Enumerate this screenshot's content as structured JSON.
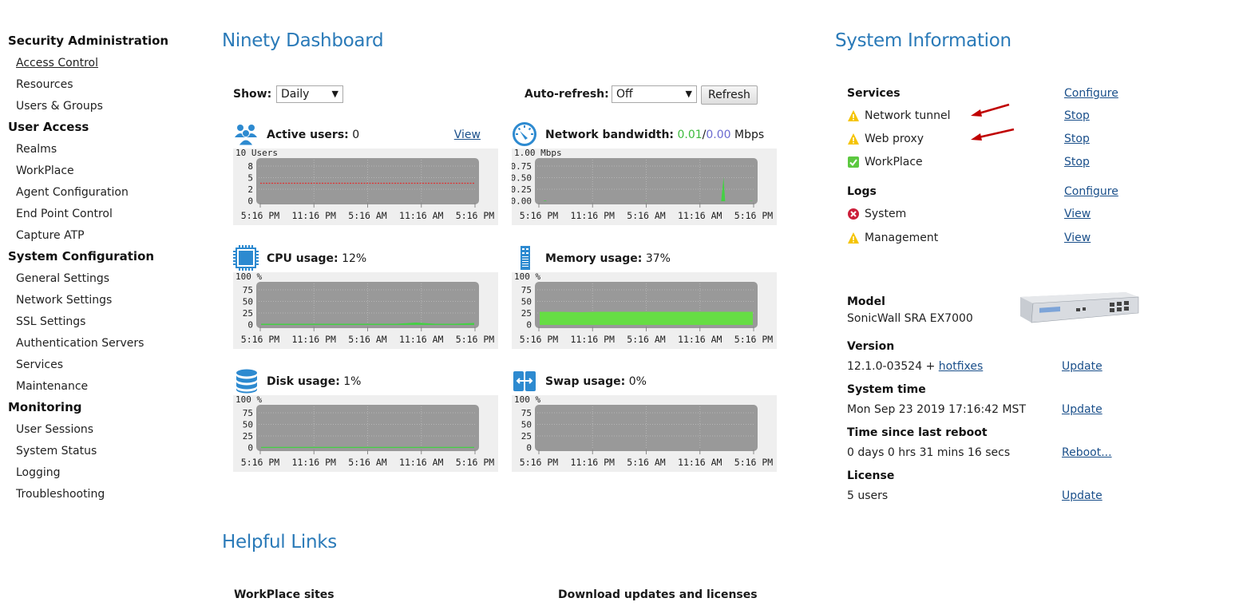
{
  "sidebar": {
    "sections": [
      {
        "title": "Security Administration",
        "items": [
          "Access Control",
          "Resources",
          "Users & Groups"
        ]
      },
      {
        "title": "User Access",
        "items": [
          "Realms",
          "WorkPlace",
          "Agent Configuration",
          "End Point Control",
          "Capture ATP"
        ]
      },
      {
        "title": "System Configuration",
        "items": [
          "General Settings",
          "Network Settings",
          "SSL Settings",
          "Authentication Servers",
          "Services",
          "Maintenance"
        ]
      },
      {
        "title": "Monitoring",
        "items": [
          "User Sessions",
          "System Status",
          "Logging",
          "Troubleshooting"
        ]
      }
    ],
    "active_item": "Access Control"
  },
  "dashboard": {
    "title": "Ninety Dashboard",
    "show_label": "Show:",
    "show_value": "Daily",
    "autorefresh_label": "Auto-refresh:",
    "autorefresh_value": "Off",
    "refresh_button": "Refresh",
    "view_link": "View"
  },
  "widgets": {
    "active_users": {
      "label": "Active users:",
      "value": "0",
      "icon": "users-icon"
    },
    "network": {
      "label": "Network bandwidth:",
      "in": "0.01",
      "sep": "/",
      "out": "0.00",
      "unit": "Mbps",
      "in_color": "#3dbb3d",
      "out_color": "#6a6ad0",
      "icon": "gauge-icon"
    },
    "cpu": {
      "label": "CPU usage:",
      "value": "12%",
      "icon": "cpu-icon"
    },
    "memory": {
      "label": "Memory usage:",
      "value": "37%",
      "icon": "memory-icon"
    },
    "disk": {
      "label": "Disk usage:",
      "value": "1%",
      "icon": "database-icon"
    },
    "swap": {
      "label": "Swap usage:",
      "value": "0%",
      "icon": "swap-icon"
    }
  },
  "chart_data": [
    {
      "id": "active_users",
      "type": "line",
      "unit_label": "10 Users",
      "yticks": [
        "8",
        "5",
        "2",
        "0"
      ],
      "ylim": [
        0,
        10
      ],
      "x": [
        "5:16 PM",
        "11:16 PM",
        "5:16 AM",
        "11:16 AM",
        "5:16 PM"
      ],
      "series": [
        {
          "name": "limit",
          "style": "dashed",
          "color": "#e03030",
          "values": [
            4.5,
            4.5,
            4.5,
            4.5,
            4.5
          ]
        },
        {
          "name": "active users",
          "color": "#44d044",
          "values": [
            0,
            0,
            0,
            0,
            0
          ]
        }
      ]
    },
    {
      "id": "network",
      "type": "area",
      "unit_label": "1.00 Mbps",
      "yticks": [
        "0.75",
        "0.50",
        "0.25",
        "0.00"
      ],
      "ylim": [
        0,
        1.0
      ],
      "x": [
        "5:16 PM",
        "11:16 PM",
        "5:16 AM",
        "11:16 AM",
        "5:16 PM"
      ],
      "series": [
        {
          "name": "in",
          "color": "#44d044",
          "points": [
            [
              0.03,
              0.02
            ],
            [
              0.5,
              0.005
            ],
            [
              0.86,
              0.6
            ],
            [
              0.99,
              0.01
            ]
          ]
        }
      ]
    },
    {
      "id": "cpu",
      "type": "area",
      "unit_label": "100 %",
      "yticks": [
        "75",
        "50",
        "25",
        "0"
      ],
      "ylim": [
        0,
        100
      ],
      "x": [
        "5:16 PM",
        "11:16 PM",
        "5:16 AM",
        "11:16 AM",
        "5:16 PM"
      ],
      "series": [
        {
          "name": "cpu",
          "color": "#44d044",
          "values": [
            3,
            3,
            3,
            3,
            3,
            3,
            3,
            3,
            6,
            3,
            3,
            5
          ]
        }
      ]
    },
    {
      "id": "memory",
      "type": "area",
      "unit_label": "100 %",
      "yticks": [
        "75",
        "50",
        "25",
        "0"
      ],
      "ylim": [
        0,
        100
      ],
      "x": [
        "5:16 PM",
        "11:16 PM",
        "5:16 AM",
        "11:16 AM",
        "5:16 PM"
      ],
      "series": [
        {
          "name": "memory",
          "color": "#66dd44",
          "values": [
            33,
            33,
            32,
            33,
            33,
            33,
            33,
            33,
            33,
            33,
            33,
            33
          ]
        }
      ]
    },
    {
      "id": "disk",
      "type": "area",
      "unit_label": "100 %",
      "yticks": [
        "75",
        "50",
        "25",
        "0"
      ],
      "ylim": [
        0,
        100
      ],
      "x": [
        "5:16 PM",
        "11:16 PM",
        "5:16 AM",
        "11:16 AM",
        "5:16 PM"
      ],
      "series": [
        {
          "name": "disk",
          "color": "#44d044",
          "values": [
            1,
            1,
            1,
            1,
            1
          ]
        }
      ]
    },
    {
      "id": "swap",
      "type": "area",
      "unit_label": "100 %",
      "yticks": [
        "75",
        "50",
        "25",
        "0"
      ],
      "ylim": [
        0,
        100
      ],
      "x": [
        "5:16 PM",
        "11:16 PM",
        "5:16 AM",
        "11:16 AM",
        "5:16 PM"
      ],
      "series": [
        {
          "name": "swap",
          "color": "#44d044",
          "values": [
            0,
            0,
            0,
            0,
            0
          ]
        }
      ]
    }
  ],
  "system_info": {
    "title": "System Information",
    "services": {
      "label": "Services",
      "configure": "Configure",
      "items": [
        {
          "name": "Network tunnel",
          "status": "warning",
          "action": "Stop"
        },
        {
          "name": "Web proxy",
          "status": "warning",
          "action": "Stop"
        },
        {
          "name": "WorkPlace",
          "status": "ok",
          "action": "Stop"
        }
      ]
    },
    "logs": {
      "label": "Logs",
      "configure": "Configure",
      "items": [
        {
          "name": "System",
          "status": "error",
          "action": "View"
        },
        {
          "name": "Management",
          "status": "warning",
          "action": "View"
        }
      ]
    },
    "model": {
      "label": "Model",
      "value": "SonicWall SRA EX7000"
    },
    "version": {
      "label": "Version",
      "value": "12.1.0-03524 +",
      "link": "hotfixes",
      "action": "Update"
    },
    "system_time": {
      "label": "System time",
      "value": "Mon Sep 23 2019 17:16:42 MST",
      "action": "Update"
    },
    "uptime": {
      "label": "Time since last reboot",
      "value": "0 days 0 hrs 31 mins 16 secs",
      "action": "Reboot..."
    },
    "license": {
      "label": "License",
      "value": "5 users",
      "action": "Update"
    }
  },
  "helpful_links": {
    "title": "Helpful Links",
    "columns": [
      "WorkPlace sites",
      "Download updates and licenses"
    ]
  },
  "colors": {
    "heading": "#2a7ab8",
    "link": "#1a4f8a",
    "icon_blue": "#2d8ad0",
    "warning": "#f5c400",
    "ok": "#5cc840",
    "error": "#cc1f3a",
    "annotation_arrow": "#c00000"
  }
}
